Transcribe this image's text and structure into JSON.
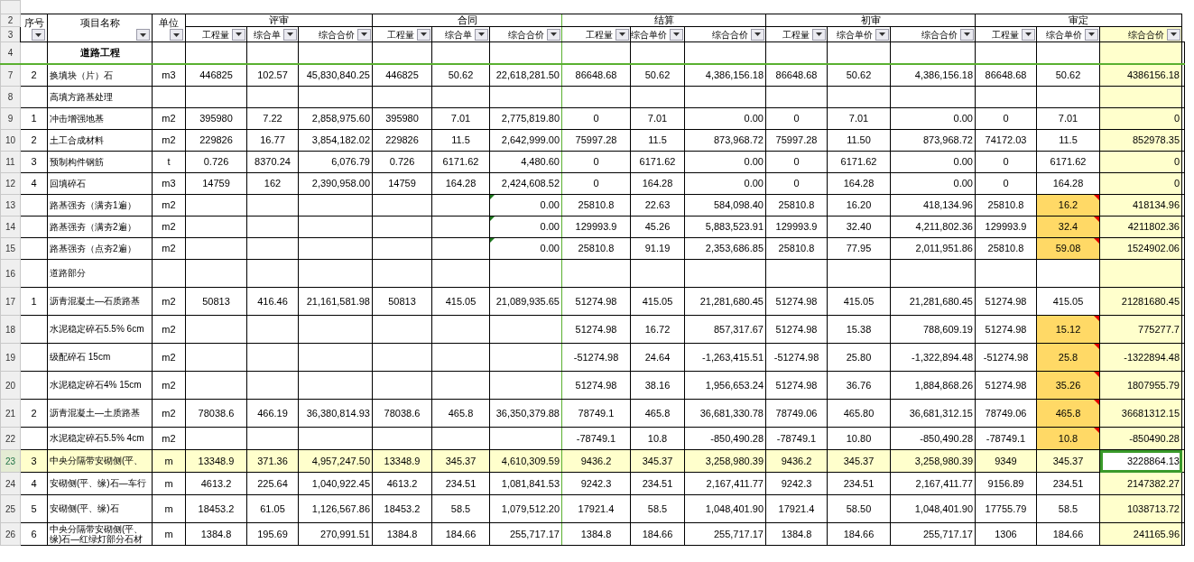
{
  "header": {
    "row_numbers": [
      "2",
      "3"
    ],
    "seq": "序号",
    "name": "项目名称",
    "unit": "单位",
    "groups": [
      {
        "title": "评审",
        "columns": [
          "工程量",
          "综合单",
          "综合合价"
        ]
      },
      {
        "title": "合同",
        "columns": [
          "工程量",
          "综合单",
          "综合合价"
        ]
      },
      {
        "title": "结算",
        "columns": [
          "工程量",
          "综合单价",
          "综合合价"
        ]
      },
      {
        "title": "初审",
        "columns": [
          "工程量",
          "综合单价",
          "综合合价"
        ]
      },
      {
        "title": "审定",
        "columns": [
          "工程量",
          "综合单价",
          "综合合价"
        ]
      }
    ]
  },
  "rows": [
    {
      "row_number": "4",
      "kind": "section",
      "name": "道路工程",
      "selected": false,
      "price_revised": false,
      "contract_note": false
    },
    {
      "row_number": "7",
      "kind": "item",
      "seq": "2",
      "name": "换填块（片）石",
      "unit": "m3",
      "review": {
        "qty": "446825",
        "price": "102.57",
        "total": "45,830,840.25"
      },
      "contract": {
        "qty": "446825",
        "price": "50.62",
        "total": "22,618,281.50"
      },
      "settlement": {
        "qty": "86648.68",
        "price": "50.62",
        "total": "4,386,156.18"
      },
      "first_audit": {
        "qty": "86648.68",
        "price": "50.62",
        "total": "4,386,156.18"
      },
      "approved": {
        "qty": "86648.68",
        "price": "50.62",
        "total": "4386156.18"
      },
      "selected": false,
      "price_revised": false,
      "contract_note": false
    },
    {
      "row_number": "8",
      "kind": "item",
      "name": "高填方路基处理",
      "selected": false,
      "price_revised": false,
      "contract_note": false
    },
    {
      "row_number": "9",
      "kind": "item",
      "seq": "1",
      "name": "冲击增强地基",
      "unit": "m2",
      "review": {
        "qty": "395980",
        "price": "7.22",
        "total": "2,858,975.60"
      },
      "contract": {
        "qty": "395980",
        "price": "7.01",
        "total": "2,775,819.80"
      },
      "settlement": {
        "qty": "0",
        "price": "7.01",
        "total": "0.00"
      },
      "first_audit": {
        "qty": "0",
        "price": "7.01",
        "total": "0.00"
      },
      "approved": {
        "qty": "0",
        "price": "7.01",
        "total": "0"
      },
      "selected": false,
      "price_revised": false,
      "contract_note": false
    },
    {
      "row_number": "10",
      "kind": "item",
      "seq": "2",
      "name": "土工合成材料",
      "unit": "m2",
      "review": {
        "qty": "229826",
        "price": "16.77",
        "total": "3,854,182.02"
      },
      "contract": {
        "qty": "229826",
        "price": "11.5",
        "total": "2,642,999.00"
      },
      "settlement": {
        "qty": "75997.28",
        "price": "11.5",
        "total": "873,968.72"
      },
      "first_audit": {
        "qty": "75997.28",
        "price": "11.50",
        "total": "873,968.72"
      },
      "approved": {
        "qty": "74172.03",
        "price": "11.5",
        "total": "852978.35"
      },
      "selected": false,
      "price_revised": false,
      "contract_note": false
    },
    {
      "row_number": "11",
      "kind": "item",
      "seq": "3",
      "name": "预制构件钢筋",
      "unit": "t",
      "review": {
        "qty": "0.726",
        "price": "8370.24",
        "total": "6,076.79"
      },
      "contract": {
        "qty": "0.726",
        "price": "6171.62",
        "total": "4,480.60"
      },
      "settlement": {
        "qty": "0",
        "price": "6171.62",
        "total": "0.00"
      },
      "first_audit": {
        "qty": "0",
        "price": "6171.62",
        "total": "0.00"
      },
      "approved": {
        "qty": "0",
        "price": "6171.62",
        "total": "0"
      },
      "selected": false,
      "price_revised": false,
      "contract_note": false
    },
    {
      "row_number": "12",
      "kind": "item",
      "seq": "4",
      "name": "回填碎石",
      "unit": "m3",
      "review": {
        "qty": "14759",
        "price": "162",
        "total": "2,390,958.00"
      },
      "contract": {
        "qty": "14759",
        "price": "164.28",
        "total": "2,424,608.52"
      },
      "settlement": {
        "qty": "0",
        "price": "164.28",
        "total": "0.00"
      },
      "first_audit": {
        "qty": "0",
        "price": "164.28",
        "total": "0.00"
      },
      "approved": {
        "qty": "0",
        "price": "164.28",
        "total": "0"
      },
      "selected": false,
      "price_revised": false,
      "contract_note": false
    },
    {
      "row_number": "13",
      "kind": "item",
      "name": "路基强夯（满夯1遍）",
      "unit": "m2",
      "contract": {
        "total": "0.00"
      },
      "settlement": {
        "qty": "25810.8",
        "price": "22.63",
        "total": "584,098.40"
      },
      "first_audit": {
        "qty": "25810.8",
        "price": "16.20",
        "total": "418,134.96"
      },
      "approved": {
        "qty": "25810.8",
        "price": "16.2",
        "total": "418134.96"
      },
      "selected": false,
      "price_revised": true,
      "contract_note": true
    },
    {
      "row_number": "14",
      "kind": "item",
      "name": "路基强夯（满夯2遍）",
      "unit": "m2",
      "contract": {
        "total": "0.00"
      },
      "settlement": {
        "qty": "129993.9",
        "price": "45.26",
        "total": "5,883,523.91"
      },
      "first_audit": {
        "qty": "129993.9",
        "price": "32.40",
        "total": "4,211,802.36"
      },
      "approved": {
        "qty": "129993.9",
        "price": "32.4",
        "total": "4211802.36"
      },
      "selected": false,
      "price_revised": true,
      "contract_note": true
    },
    {
      "row_number": "15",
      "kind": "item",
      "name": "路基强夯（点夯2遍）",
      "unit": "m2",
      "contract": {
        "total": "0.00"
      },
      "settlement": {
        "qty": "25810.8",
        "price": "91.19",
        "total": "2,353,686.85"
      },
      "first_audit": {
        "qty": "25810.8",
        "price": "77.95",
        "total": "2,011,951.86"
      },
      "approved": {
        "qty": "25810.8",
        "price": "59.08",
        "total": "1524902.06"
      },
      "selected": false,
      "price_revised": true,
      "contract_note": true
    },
    {
      "row_number": "16",
      "kind": "item",
      "name": "道路部分",
      "selected": false,
      "price_revised": false,
      "contract_note": false
    },
    {
      "row_number": "17",
      "kind": "item",
      "seq": "1",
      "name": "沥青混凝土—石质路基",
      "unit": "m2",
      "review": {
        "qty": "50813",
        "price": "416.46",
        "total": "21,161,581.98"
      },
      "contract": {
        "qty": "50813",
        "price": "415.05",
        "total": "21,089,935.65"
      },
      "settlement": {
        "qty": "51274.98",
        "price": "415.05",
        "total": "21,281,680.45"
      },
      "first_audit": {
        "qty": "51274.98",
        "price": "415.05",
        "total": "21,281,680.45"
      },
      "approved": {
        "qty": "51274.98",
        "price": "415.05",
        "total": "21281680.45"
      },
      "selected": false,
      "price_revised": false,
      "contract_note": false
    },
    {
      "row_number": "18",
      "kind": "item",
      "name": "水泥稳定碎石5.5%  6cm",
      "unit": "m2",
      "settlement": {
        "qty": "51274.98",
        "price": "16.72",
        "total": "857,317.67"
      },
      "first_audit": {
        "qty": "51274.98",
        "price": "15.38",
        "total": "788,609.19"
      },
      "approved": {
        "qty": "51274.98",
        "price": "15.12",
        "total": "775277.7"
      },
      "selected": false,
      "price_revised": true,
      "contract_note": false
    },
    {
      "row_number": "19",
      "kind": "item",
      "name": "级配碎石  15cm",
      "unit": "m2",
      "settlement": {
        "qty": "-51274.98",
        "price": "24.64",
        "total": "-1,263,415.51"
      },
      "first_audit": {
        "qty": "-51274.98",
        "price": "25.80",
        "total": "-1,322,894.48"
      },
      "approved": {
        "qty": "-51274.98",
        "price": "25.8",
        "total": "-1322894.48"
      },
      "selected": false,
      "price_revised": true,
      "contract_note": false
    },
    {
      "row_number": "20",
      "kind": "item",
      "name": "水泥稳定碎石4%  15cm",
      "unit": "m2",
      "settlement": {
        "qty": "51274.98",
        "price": "38.16",
        "total": "1,956,653.24"
      },
      "first_audit": {
        "qty": "51274.98",
        "price": "36.76",
        "total": "1,884,868.26"
      },
      "approved": {
        "qty": "51274.98",
        "price": "35.26",
        "total": "1807955.79"
      },
      "selected": false,
      "price_revised": true,
      "contract_note": false
    },
    {
      "row_number": "21",
      "kind": "item",
      "seq": "2",
      "name": "沥青混凝土—土质路基",
      "unit": "m2",
      "review": {
        "qty": "78038.6",
        "price": "466.19",
        "total": "36,380,814.93"
      },
      "contract": {
        "qty": "78038.6",
        "price": "465.8",
        "total": "36,350,379.88"
      },
      "settlement": {
        "qty": "78749.1",
        "price": "465.8",
        "total": "36,681,330.78"
      },
      "first_audit": {
        "qty": "78749.06",
        "price": "465.80",
        "total": "36,681,312.15"
      },
      "approved": {
        "qty": "78749.06",
        "price": "465.8",
        "total": "36681312.15"
      },
      "selected": false,
      "price_revised": true,
      "contract_note": false
    },
    {
      "row_number": "22",
      "kind": "item",
      "name": "水泥稳定碎石5.5%  4cm",
      "unit": "m2",
      "settlement": {
        "qty": "-78749.1",
        "price": "10.8",
        "total": "-850,490.28"
      },
      "first_audit": {
        "qty": "-78749.1",
        "price": "10.80",
        "total": "-850,490.28"
      },
      "approved": {
        "qty": "-78749.1",
        "price": "10.8",
        "total": "-850490.28"
      },
      "selected": false,
      "price_revised": true,
      "contract_note": false
    },
    {
      "row_number": "23",
      "kind": "item",
      "seq": "3",
      "name": "中央分隔带安砌侧(平、",
      "unit": "m",
      "review": {
        "qty": "13348.9",
        "price": "371.36",
        "total": "4,957,247.50"
      },
      "contract": {
        "qty": "13348.9",
        "price": "345.37",
        "total": "4,610,309.59"
      },
      "settlement": {
        "qty": "9436.2",
        "price": "345.37",
        "total": "3,258,980.39"
      },
      "first_audit": {
        "qty": "9436.2",
        "price": "345.37",
        "total": "3,258,980.39"
      },
      "approved": {
        "qty": "9349",
        "price": "345.37",
        "total": "3228864.13"
      },
      "selected": true,
      "price_revised": false,
      "contract_note": false
    },
    {
      "row_number": "24",
      "kind": "item",
      "seq": "4",
      "name": "安砌侧(平、缘)石—车行",
      "unit": "m",
      "review": {
        "qty": "4613.2",
        "price": "225.64",
        "total": "1,040,922.45"
      },
      "contract": {
        "qty": "4613.2",
        "price": "234.51",
        "total": "1,081,841.53"
      },
      "settlement": {
        "qty": "9242.3",
        "price": "234.51",
        "total": "2,167,411.77"
      },
      "first_audit": {
        "qty": "9242.3",
        "price": "234.51",
        "total": "2,167,411.77"
      },
      "approved": {
        "qty": "9156.89",
        "price": "234.51",
        "total": "2147382.27"
      },
      "selected": false,
      "price_revised": false,
      "contract_note": false
    },
    {
      "row_number": "25",
      "kind": "item",
      "seq": "5",
      "name": "安砌侧(平、缘)石",
      "unit": "m",
      "review": {
        "qty": "18453.2",
        "price": "61.05",
        "total": "1,126,567.86"
      },
      "contract": {
        "qty": "18453.2",
        "price": "58.5",
        "total": "1,079,512.20"
      },
      "settlement": {
        "qty": "17921.4",
        "price": "58.5",
        "total": "1,048,401.90"
      },
      "first_audit": {
        "qty": "17921.4",
        "price": "58.50",
        "total": "1,048,401.90"
      },
      "approved": {
        "qty": "17755.79",
        "price": "58.5",
        "total": "1038713.72"
      },
      "selected": false,
      "price_revised": false,
      "contract_note": false
    },
    {
      "row_number": "26",
      "kind": "item",
      "seq": "6",
      "name": "中央分隔带安砌侧(平、缘)石—红绿灯部分石材",
      "unit": "m",
      "review": {
        "qty": "1384.8",
        "price": "195.69",
        "total": "270,991.51"
      },
      "contract": {
        "qty": "1384.8",
        "price": "184.66",
        "total": "255,717.17"
      },
      "settlement": {
        "qty": "1384.8",
        "price": "184.66",
        "total": "255,717.17"
      },
      "first_audit": {
        "qty": "1384.8",
        "price": "184.66",
        "total": "255,717.17"
      },
      "approved": {
        "qty": "1306",
        "price": "184.66",
        "total": "241165.96"
      },
      "selected": false,
      "price_revised": false,
      "contract_note": false
    }
  ]
}
